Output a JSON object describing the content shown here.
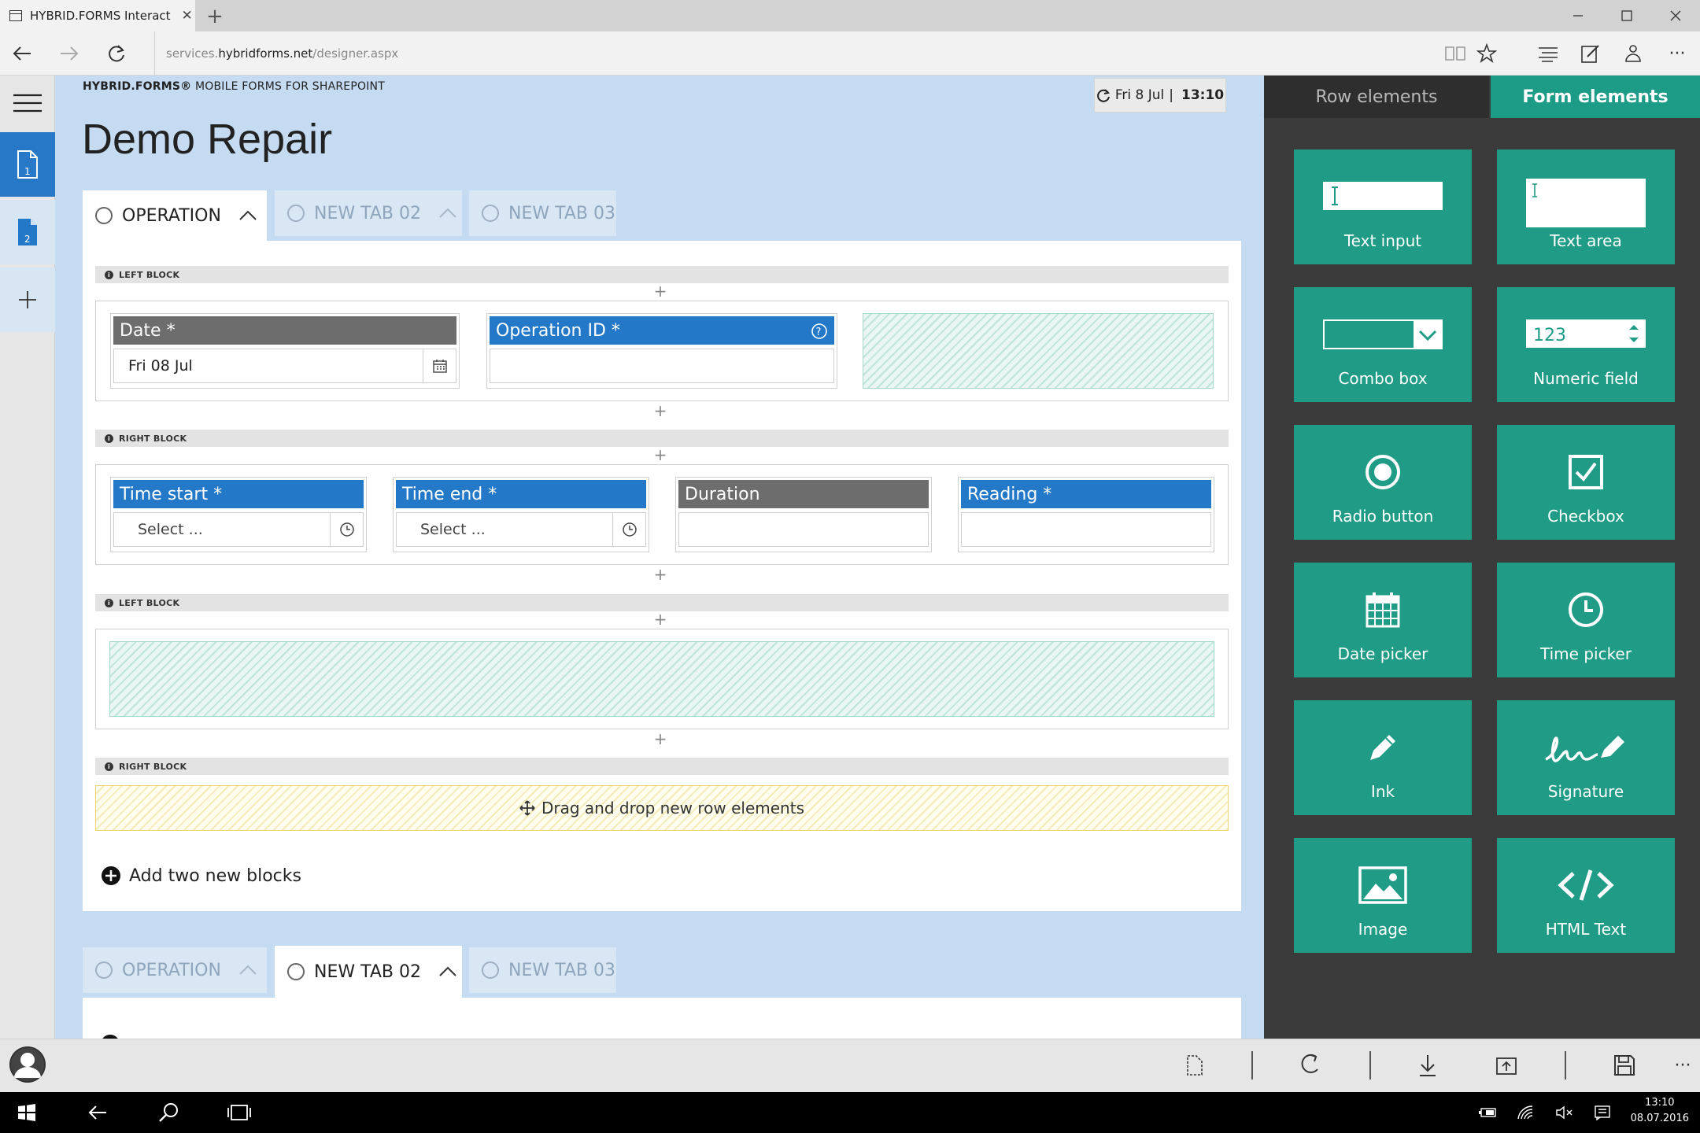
{
  "browser": {
    "tab_title": "HYBRID.FORMS Interact",
    "url_prefix": "services.",
    "url_domain": "hybridforms.net",
    "url_path": "/designer.aspx"
  },
  "rail": {
    "page1_number": "1",
    "page2_number": "2"
  },
  "header": {
    "brand_bold": "HYBRID.FORMS®",
    "brand_rest": " MOBILE FORMS FOR SHAREPOINT",
    "date": "Fri 8 Jul",
    "separator": "|",
    "time": "13:10",
    "title": "Demo Repair"
  },
  "tabs": [
    {
      "label": "OPERATION"
    },
    {
      "label": "NEW TAB 02"
    },
    {
      "label": "NEW TAB 03"
    }
  ],
  "blocks": {
    "left_block": "LEFT BLOCK",
    "right_block": "RIGHT BLOCK"
  },
  "row1": {
    "date_label": "Date *",
    "date_value": "Fri 08 Jul",
    "opid_label": "Operation ID *"
  },
  "row2": {
    "time_start_label": "Time start *",
    "time_start_placeholder": "Select ...",
    "time_end_label": "Time end *",
    "time_end_placeholder": "Select ...",
    "duration_label": "Duration",
    "reading_label": "Reading *"
  },
  "dropzone": "Drag and drop new row elements",
  "add_blocks": "Add two new blocks",
  "palette": {
    "tab_row": "Row elements",
    "tab_form": "Form elements",
    "tiles": [
      {
        "label": "Text input",
        "icon": "text-input-icon"
      },
      {
        "label": "Text area",
        "icon": "text-area-icon"
      },
      {
        "label": "Combo box",
        "icon": "combo-box-icon"
      },
      {
        "label": "Numeric field",
        "icon": "numeric-field-icon",
        "sample": "123"
      },
      {
        "label": "Radio button",
        "icon": "radio-button-icon"
      },
      {
        "label": "Checkbox",
        "icon": "checkbox-icon"
      },
      {
        "label": "Date picker",
        "icon": "date-picker-icon"
      },
      {
        "label": "Time picker",
        "icon": "time-picker-icon"
      },
      {
        "label": "Ink",
        "icon": "pencil-icon"
      },
      {
        "label": "Signature",
        "icon": "signature-icon"
      },
      {
        "label": "Image",
        "icon": "image-icon"
      },
      {
        "label": "HTML Text",
        "icon": "code-icon"
      }
    ]
  },
  "taskbar": {
    "time": "13:10",
    "date": "08.07.2016"
  },
  "colors": {
    "accent_blue": "#2378c8",
    "teal": "#1f9b86",
    "canvas_bg": "#c5dbf1",
    "palette_bg": "#3b3b3b"
  }
}
